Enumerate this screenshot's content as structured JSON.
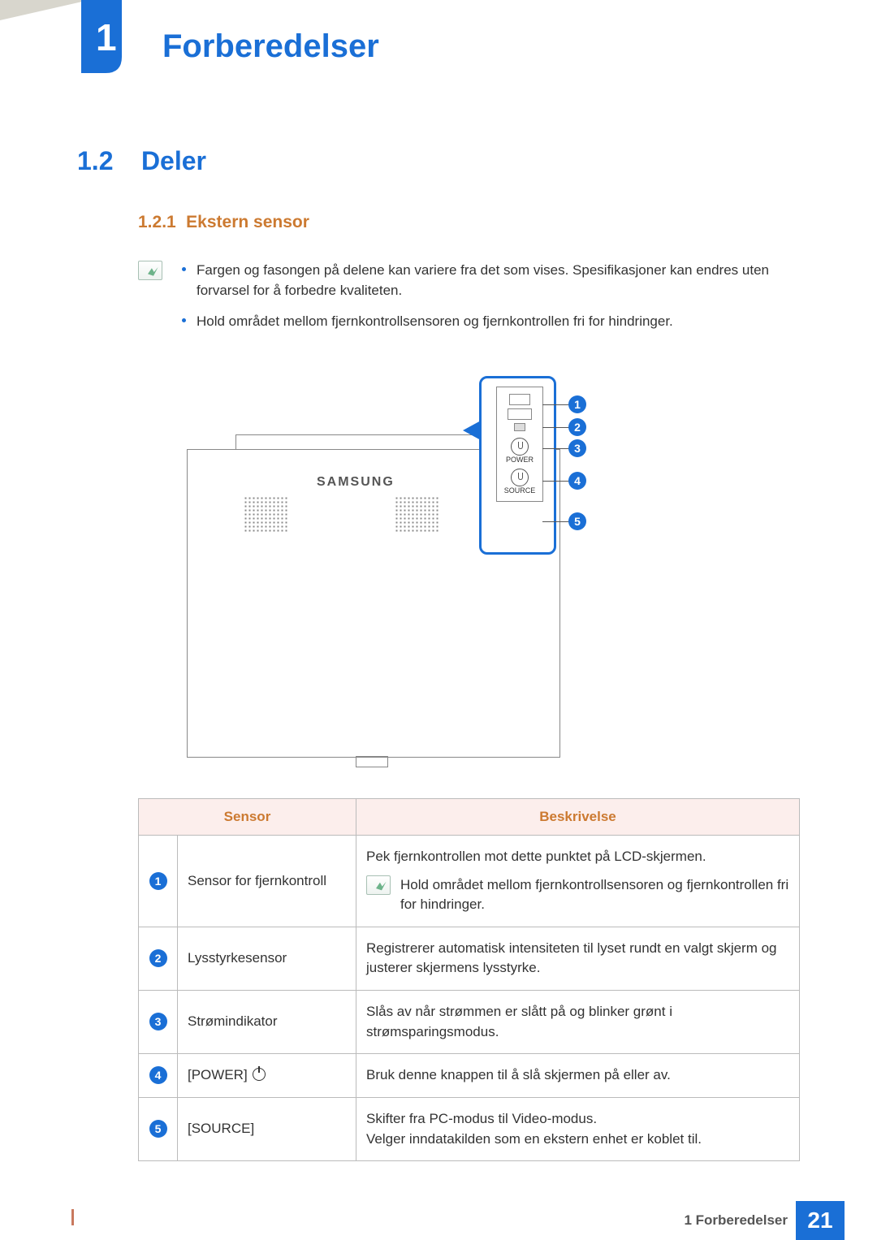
{
  "chapter": {
    "number": "1",
    "title": "Forberedelser"
  },
  "section": {
    "number": "1.2",
    "title": "Deler"
  },
  "subsection": {
    "number": "1.2.1",
    "title": "Ekstern sensor"
  },
  "notes": [
    "Fargen og fasongen på delene kan variere fra det som vises. Spesifikasjoner kan endres uten forvarsel for å forbedre kvaliteten.",
    "Hold området mellom fjernkontrollsensoren og fjernkontrollen fri for hindringer."
  ],
  "diagram": {
    "logo": "SAMSUNG",
    "sensor_labels": {
      "power": "POWER",
      "source": "SOURCE"
    },
    "callouts": [
      "1",
      "2",
      "3",
      "4",
      "5"
    ]
  },
  "table": {
    "headers": {
      "sensor": "Sensor",
      "description": "Beskrivelse"
    },
    "rows": [
      {
        "num": "1",
        "sensor": "Sensor for fjernkontroll",
        "desc": "Pek fjernkontrollen mot dette punktet på LCD-skjermen.",
        "note": "Hold området mellom fjernkontrollsensoren og fjernkontrollen fri for hindringer."
      },
      {
        "num": "2",
        "sensor": "Lysstyrkesensor",
        "desc": "Registrerer automatisk intensiteten til lyset rundt en valgt skjerm og justerer skjermens lysstyrke."
      },
      {
        "num": "3",
        "sensor": "Strømindikator",
        "desc": "Slås av når strømmen er slått på og blinker grønt i strømsparingsmodus."
      },
      {
        "num": "4",
        "sensor": "[POWER]",
        "desc": "Bruk denne knappen til å slå skjermen på eller av."
      },
      {
        "num": "5",
        "sensor": "[SOURCE]",
        "desc": "Skifter fra PC-modus til Video-modus.\nVelger inndatakilden som en ekstern enhet er koblet til."
      }
    ]
  },
  "footer": {
    "text": "1 Forberedelser",
    "page": "21"
  }
}
